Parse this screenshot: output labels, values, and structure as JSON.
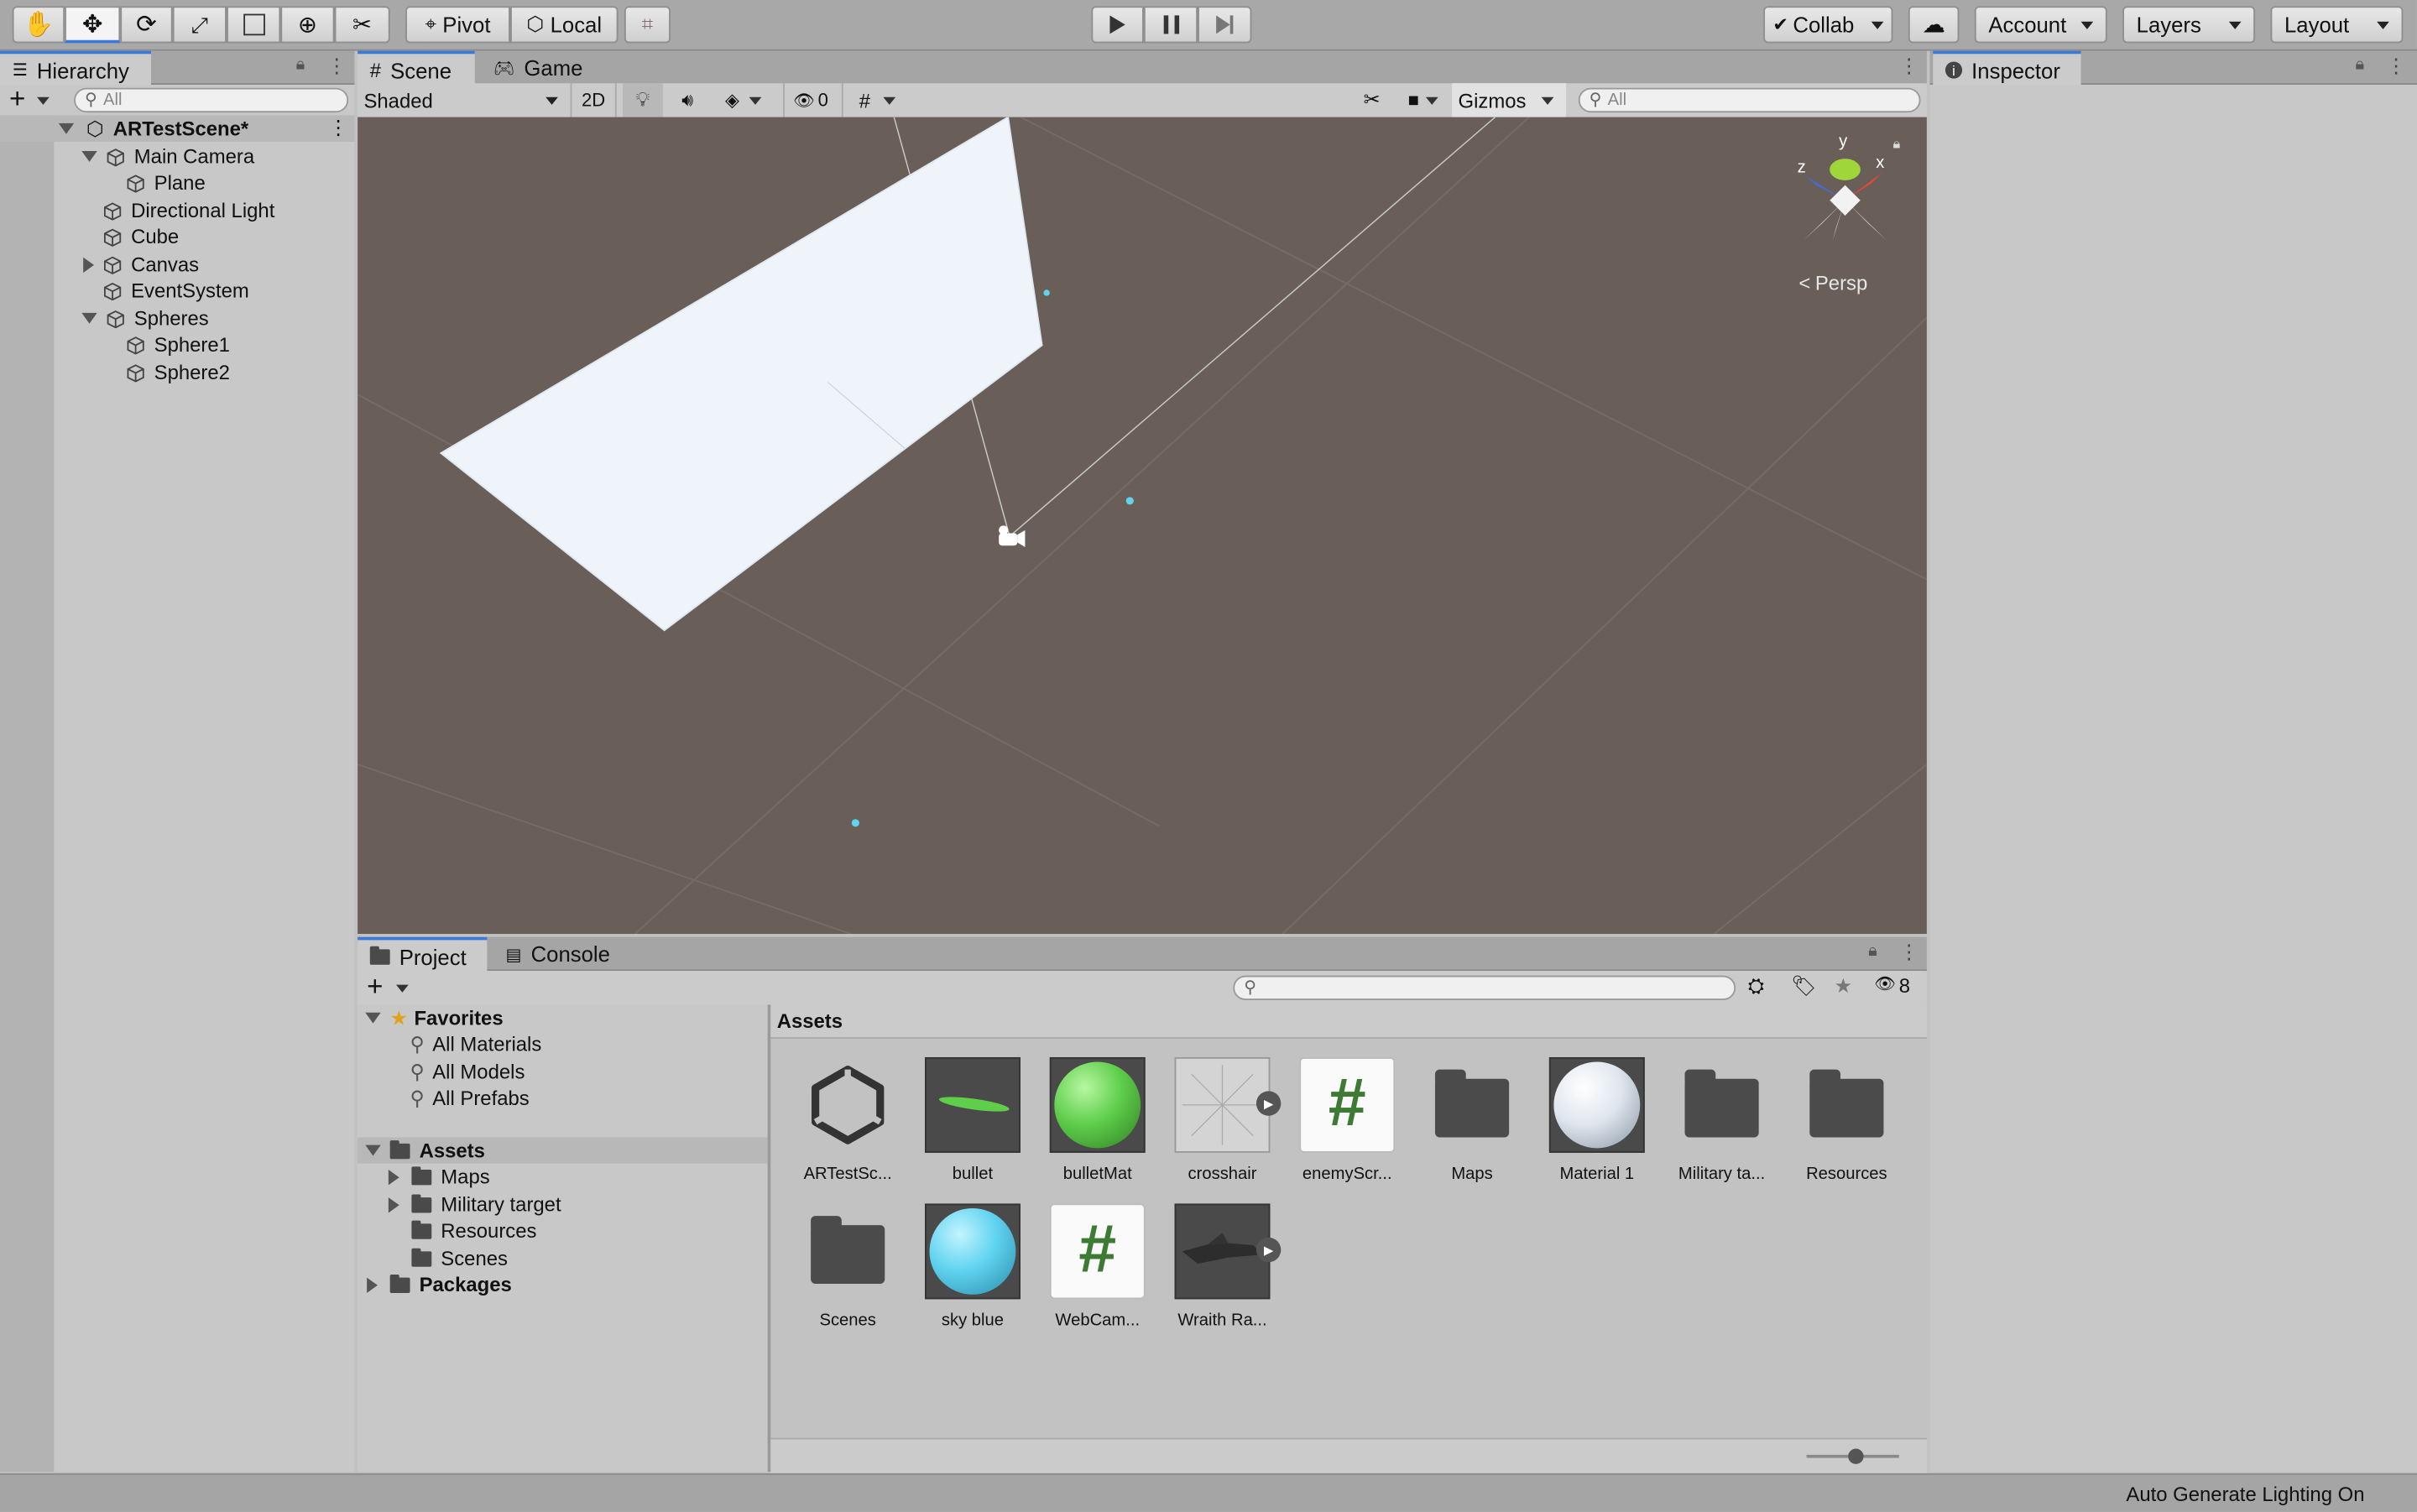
{
  "toolbar": {
    "pivot_label": "Pivot",
    "local_label": "Local",
    "collab_label": "Collab",
    "account_label": "Account",
    "layers_label": "Layers",
    "layout_label": "Layout"
  },
  "hierarchy": {
    "tab_label": "Hierarchy",
    "search_placeholder": "All",
    "scene_name": "ARTestScene*",
    "items": [
      {
        "label": "Main Camera"
      },
      {
        "label": "Plane"
      },
      {
        "label": "Directional Light"
      },
      {
        "label": "Cube"
      },
      {
        "label": "Canvas"
      },
      {
        "label": "EventSystem"
      },
      {
        "label": "Spheres"
      },
      {
        "label": "Sphere1"
      },
      {
        "label": "Sphere2"
      }
    ]
  },
  "scene": {
    "tabs": [
      {
        "label": "Scene"
      },
      {
        "label": "Game"
      }
    ],
    "shading_mode": "Shaded",
    "mode_2d": "2D",
    "hidden_count": "0",
    "gizmos_label": "Gizmos",
    "search_placeholder": "All",
    "gizmo_x": "x",
    "gizmo_y": "y",
    "gizmo_z": "z",
    "projection_label": "Persp"
  },
  "inspector": {
    "tab_label": "Inspector"
  },
  "project": {
    "tabs": [
      {
        "label": "Project"
      },
      {
        "label": "Console"
      }
    ],
    "hidden_count": "8",
    "favorites": {
      "label": "Favorites",
      "items": [
        {
          "label": "All Materials"
        },
        {
          "label": "All Models"
        },
        {
          "label": "All Prefabs"
        }
      ]
    },
    "assets_tree": {
      "label": "Assets",
      "children": [
        {
          "label": "Maps"
        },
        {
          "label": "Military target"
        },
        {
          "label": "Resources"
        },
        {
          "label": "Scenes"
        }
      ]
    },
    "packages_label": "Packages",
    "breadcrumb": "Assets",
    "assets": [
      {
        "label": "ARTestSc..."
      },
      {
        "label": "bullet"
      },
      {
        "label": "bulletMat"
      },
      {
        "label": "crosshair"
      },
      {
        "label": "enemyScr..."
      },
      {
        "label": "Maps"
      },
      {
        "label": "Material 1"
      },
      {
        "label": "Military ta..."
      },
      {
        "label": "Resources"
      },
      {
        "label": "Scenes"
      },
      {
        "label": "sky blue"
      },
      {
        "label": "WebCam..."
      },
      {
        "label": "Wraith Ra..."
      }
    ]
  },
  "status_bar": {
    "text": "Auto Generate Lighting On"
  },
  "colors": {
    "scene_bg": "#6a5f58",
    "accent": "#3a79d8",
    "script_hash": "#3d7a34",
    "sky_blue": "#5fd3f0",
    "green_mat": "#5fce4b"
  }
}
